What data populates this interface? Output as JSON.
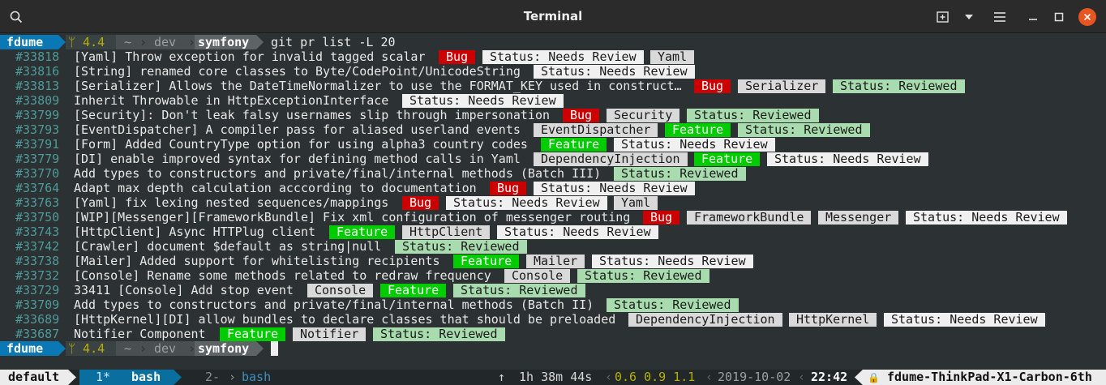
{
  "window": {
    "title": "Terminal"
  },
  "prompt": {
    "user": "fdume",
    "branch_glyph": "ᛘ",
    "version": "4.4",
    "home": "~",
    "dir": "dev",
    "current": "symfony",
    "command": "git pr list -L 20"
  },
  "prs": [
    {
      "num": "#33818",
      "title": "[Yaml] Throw exception for invalid tagged scalar",
      "labels": [
        {
          "t": "Bug",
          "k": "bug"
        },
        {
          "t": "Status: Needs Review",
          "k": "needs"
        },
        {
          "t": "Yaml",
          "k": "comp"
        }
      ]
    },
    {
      "num": "#33816",
      "title": "[String] renamed core classes to Byte/CodePoint/UnicodeString",
      "labels": [
        {
          "t": "Status: Needs Review",
          "k": "needs"
        }
      ]
    },
    {
      "num": "#33813",
      "title": "[Serializer] Allows the DateTimeNormalizer to use the FORMAT_KEY used in construct…",
      "labels": [
        {
          "t": "Bug",
          "k": "bug"
        },
        {
          "t": "Serializer",
          "k": "comp"
        },
        {
          "t": "Status: Reviewed",
          "k": "reviewed"
        }
      ]
    },
    {
      "num": "#33809",
      "title": "Inherit Throwable in HttpExceptionInterface",
      "labels": [
        {
          "t": "Status: Needs Review",
          "k": "needs"
        }
      ]
    },
    {
      "num": "#33799",
      "title": "[Security]: Don't leak falsy usernames slip through impersonation",
      "labels": [
        {
          "t": "Bug",
          "k": "bug"
        },
        {
          "t": "Security",
          "k": "comp"
        },
        {
          "t": "Status: Reviewed",
          "k": "reviewed"
        }
      ]
    },
    {
      "num": "#33793",
      "title": "[EventDispatcher] A compiler pass for aliased userland events",
      "labels": [
        {
          "t": "EventDispatcher",
          "k": "comp"
        },
        {
          "t": "Feature",
          "k": "feature"
        },
        {
          "t": "Status: Reviewed",
          "k": "reviewed"
        }
      ]
    },
    {
      "num": "#33791",
      "title": "[Form] Added CountryType option for using alpha3 country codes",
      "labels": [
        {
          "t": "Feature",
          "k": "feature"
        },
        {
          "t": "Status: Needs Review",
          "k": "needs"
        }
      ]
    },
    {
      "num": "#33779",
      "title": "[DI] enable improved syntax for defining method calls in Yaml",
      "labels": [
        {
          "t": "DependencyInjection",
          "k": "comp"
        },
        {
          "t": "Feature",
          "k": "feature"
        },
        {
          "t": "Status: Needs Review",
          "k": "needs"
        }
      ]
    },
    {
      "num": "#33770",
      "title": "Add types to constructors and private/final/internal methods (Batch III)",
      "labels": [
        {
          "t": "Status: Reviewed",
          "k": "reviewed"
        }
      ]
    },
    {
      "num": "#33764",
      "title": "Adapt max depth calculation acccording to documentation",
      "labels": [
        {
          "t": "Bug",
          "k": "bug"
        },
        {
          "t": "Status: Needs Review",
          "k": "needs"
        }
      ]
    },
    {
      "num": "#33763",
      "title": "[Yaml] fix lexing nested sequences/mappings",
      "labels": [
        {
          "t": "Bug",
          "k": "bug"
        },
        {
          "t": "Status: Needs Review",
          "k": "needs"
        },
        {
          "t": "Yaml",
          "k": "comp"
        }
      ]
    },
    {
      "num": "#33750",
      "title": "[WIP][Messenger][FrameworkBundle] Fix xml configuration of messenger routing",
      "labels": [
        {
          "t": "Bug",
          "k": "bug"
        },
        {
          "t": "FrameworkBundle",
          "k": "comp"
        },
        {
          "t": "Messenger",
          "k": "comp"
        },
        {
          "t": "Status: Needs Review",
          "k": "needs"
        }
      ]
    },
    {
      "num": "#33743",
      "title": "[HttpClient] Async HTTPlug client",
      "labels": [
        {
          "t": "Feature",
          "k": "feature"
        },
        {
          "t": "HttpClient",
          "k": "comp"
        },
        {
          "t": "Status: Needs Review",
          "k": "needs"
        }
      ]
    },
    {
      "num": "#33742",
      "title": "[Crawler] document $default as string|null",
      "labels": [
        {
          "t": "Status: Reviewed",
          "k": "reviewed"
        }
      ]
    },
    {
      "num": "#33738",
      "title": "[Mailer] Added support for whitelisting recipients",
      "labels": [
        {
          "t": "Feature",
          "k": "feature"
        },
        {
          "t": "Mailer",
          "k": "comp"
        },
        {
          "t": "Status: Needs Review",
          "k": "needs"
        }
      ]
    },
    {
      "num": "#33732",
      "title": "[Console] Rename some methods related to redraw frequency",
      "labels": [
        {
          "t": "Console",
          "k": "comp"
        },
        {
          "t": "Status: Reviewed",
          "k": "reviewed"
        }
      ]
    },
    {
      "num": "#33729",
      "title": "33411 [Console] Add stop event",
      "labels": [
        {
          "t": "Console",
          "k": "comp"
        },
        {
          "t": "Feature",
          "k": "feature"
        },
        {
          "t": "Status: Reviewed",
          "k": "reviewed"
        }
      ]
    },
    {
      "num": "#33709",
      "title": "Add types to constructors and private/final/internal methods (Batch II)",
      "labels": [
        {
          "t": "Status: Reviewed",
          "k": "reviewed"
        }
      ]
    },
    {
      "num": "#33689",
      "title": "[HttpKernel][DI] allow bundles to declare classes that should be preloaded",
      "labels": [
        {
          "t": "DependencyInjection",
          "k": "comp"
        },
        {
          "t": "HttpKernel",
          "k": "comp"
        },
        {
          "t": "Status: Needs Review",
          "k": "needs"
        }
      ]
    },
    {
      "num": "#33687",
      "title": "Notifier Component",
      "labels": [
        {
          "t": "Feature",
          "k": "feature"
        },
        {
          "t": "Notifier",
          "k": "comp"
        },
        {
          "t": "Status: Reviewed",
          "k": "reviewed"
        }
      ]
    }
  ],
  "statusbar": {
    "session": "default",
    "win1": "1*",
    "win1_name": "bash",
    "win2": "2-",
    "win2_name": "bash",
    "uptime_glyph": "↑",
    "uptime": "1h 38m 44s",
    "load": "0.6 0.9 1.1",
    "date": "2019-10-02",
    "time": "22:42",
    "lock_glyph": "🔒",
    "host": "fdume-ThinkPad-X1-Carbon-6th"
  },
  "colors": {
    "bug": "#cc0000",
    "feature": "#00cc00",
    "needs_review": "#f0f0f0",
    "reviewed": "#a8dcae",
    "component": "#d9d9d9",
    "prompt_user": "#0a78b4",
    "close_button": "#e95420"
  }
}
